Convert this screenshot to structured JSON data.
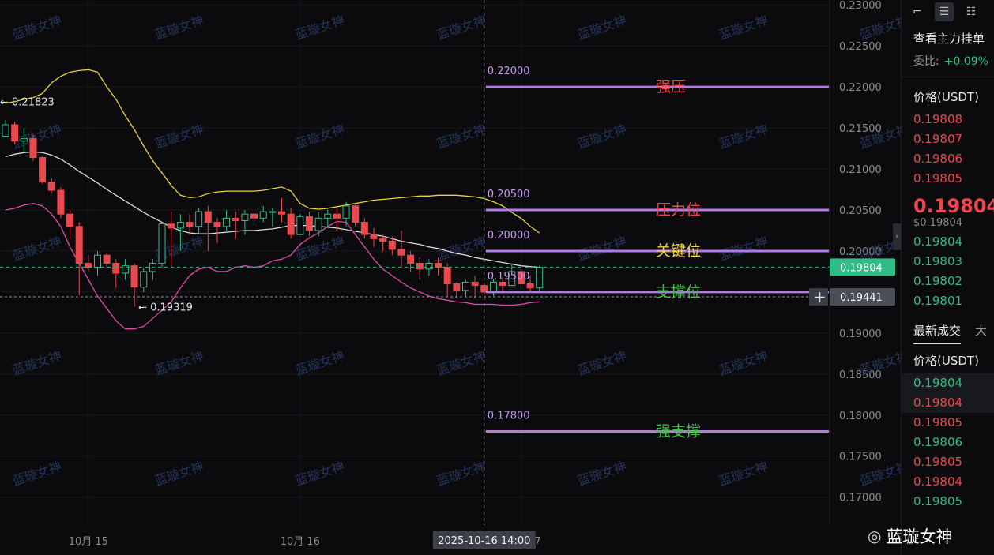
{
  "watermark": "蓝璇女神",
  "chart_data": {
    "type": "candlestick",
    "ylim": [
      0.1666,
      0.2306
    ],
    "y_ticks": [
      "0.23000",
      "0.22500",
      "0.22000",
      "0.21500",
      "0.21000",
      "0.20500",
      "0.20000",
      "0.19500",
      "0.19000",
      "0.18500",
      "0.18000",
      "0.17500",
      "0.17000"
    ],
    "x_ticks": [
      {
        "label": "10月 15",
        "index": 9
      },
      {
        "label": "10月 16",
        "index": 32
      },
      {
        "label": "10月 17",
        "index": 56
      }
    ],
    "crosshair": {
      "label": "2025-10-16 14:00",
      "index": 52
    },
    "current_price": "0.19804",
    "cursor_price": "0.19441",
    "annotations": {
      "high": {
        "label": "← 0.21823",
        "value": 0.21823,
        "index": 0
      },
      "low": {
        "label": "← 0.19319",
        "value": 0.19319,
        "index": 14
      }
    },
    "levels": [
      {
        "value": 0.22,
        "value_label": "0.22000",
        "name": "强压",
        "color": "#f0454c"
      },
      {
        "value": 0.205,
        "value_label": "0.20500",
        "name": "压力位",
        "color": "#f0454c"
      },
      {
        "value": 0.2,
        "value_label": "0.20000",
        "name": "关键位",
        "color": "#f5d142"
      },
      {
        "value": 0.195,
        "value_label": "0.19500",
        "name": "支撑位",
        "color": "#3fbf3f"
      },
      {
        "value": 0.178,
        "value_label": "0.17800",
        "name": "强支撑",
        "color": "#3fbf3f"
      }
    ],
    "candles": [
      [
        0.214,
        0.2154,
        0.215,
        0.216
      ],
      [
        0.2154,
        0.2134,
        0.213,
        0.2158
      ],
      [
        0.2134,
        0.2137,
        0.212,
        0.215
      ],
      [
        0.2137,
        0.2114,
        0.211,
        0.2142
      ],
      [
        0.2114,
        0.2084,
        0.2082,
        0.2116
      ],
      [
        0.2084,
        0.2074,
        0.207,
        0.2089
      ],
      [
        0.2074,
        0.2045,
        0.204,
        0.2078
      ],
      [
        0.2045,
        0.203,
        0.2015,
        0.205
      ],
      [
        0.203,
        0.1985,
        0.1946,
        0.2035
      ],
      [
        0.1985,
        0.198,
        0.1975,
        0.1995
      ],
      [
        0.198,
        0.1995,
        0.197,
        0.2
      ],
      [
        0.1995,
        0.1985,
        0.198,
        0.1998
      ],
      [
        0.1985,
        0.1973,
        0.1955,
        0.199
      ],
      [
        0.1973,
        0.1982,
        0.1965,
        0.199
      ],
      [
        0.1982,
        0.1956,
        0.1932,
        0.1985
      ],
      [
        0.1956,
        0.1975,
        0.195,
        0.198
      ],
      [
        0.1975,
        0.1985,
        0.1965,
        0.199
      ],
      [
        0.1985,
        0.2033,
        0.198,
        0.2035
      ],
      [
        0.2033,
        0.2028,
        0.198,
        0.2048
      ],
      [
        0.2028,
        0.2035,
        0.2,
        0.2045
      ],
      [
        0.2035,
        0.203,
        0.202,
        0.2045
      ],
      [
        0.203,
        0.2048,
        0.202,
        0.2052
      ],
      [
        0.2048,
        0.2035,
        0.2,
        0.2055
      ],
      [
        0.2035,
        0.203,
        0.201,
        0.204
      ],
      [
        0.203,
        0.204,
        0.2025,
        0.205
      ],
      [
        0.204,
        0.2037,
        0.2015,
        0.2048
      ],
      [
        0.2037,
        0.2045,
        0.202,
        0.205
      ],
      [
        0.2045,
        0.204,
        0.203,
        0.205
      ],
      [
        0.204,
        0.2048,
        0.2035,
        0.2055
      ],
      [
        0.2048,
        0.2048,
        0.203,
        0.2052
      ],
      [
        0.2048,
        0.2045,
        0.2035,
        0.2065
      ],
      [
        0.2045,
        0.202,
        0.2015,
        0.2052
      ],
      [
        0.202,
        0.2042,
        0.202,
        0.2045
      ],
      [
        0.2042,
        0.2025,
        0.2018,
        0.2048
      ],
      [
        0.2025,
        0.204,
        0.2018,
        0.2048
      ],
      [
        0.204,
        0.2045,
        0.2028,
        0.205
      ],
      [
        0.2045,
        0.204,
        0.2025,
        0.2052
      ],
      [
        0.204,
        0.2055,
        0.203,
        0.206
      ],
      [
        0.2055,
        0.2035,
        0.203,
        0.2058
      ],
      [
        0.2035,
        0.202,
        0.2015,
        0.204
      ],
      [
        0.202,
        0.2015,
        0.2005,
        0.2028
      ],
      [
        0.2015,
        0.2012,
        0.2,
        0.202
      ],
      [
        0.2012,
        0.2002,
        0.1995,
        0.2018
      ],
      [
        0.2002,
        0.1995,
        0.198,
        0.2025
      ],
      [
        0.1995,
        0.1985,
        0.1975,
        0.2
      ],
      [
        0.1985,
        0.1978,
        0.1965,
        0.1992
      ],
      [
        0.1978,
        0.1985,
        0.197,
        0.199
      ],
      [
        0.1985,
        0.198,
        0.197,
        0.1992
      ],
      [
        0.198,
        0.196,
        0.1945,
        0.1985
      ],
      [
        0.196,
        0.1952,
        0.1942,
        0.1962
      ],
      [
        0.1952,
        0.1962,
        0.1945,
        0.1965
      ],
      [
        0.1962,
        0.1958,
        0.1942,
        0.197
      ],
      [
        0.1958,
        0.195,
        0.194,
        0.1962
      ],
      [
        0.195,
        0.1962,
        0.1945,
        0.1966
      ],
      [
        0.1962,
        0.1958,
        0.195,
        0.1968
      ],
      [
        0.1958,
        0.1975,
        0.1958,
        0.1985
      ],
      [
        0.1975,
        0.196,
        0.1955,
        0.1978
      ],
      [
        0.196,
        0.1955,
        0.195,
        0.197
      ],
      [
        0.1955,
        0.198,
        0.1952,
        0.1982
      ]
    ],
    "boll_upper": [
      0.218,
      0.2182,
      0.2185,
      0.2187,
      0.2192,
      0.2205,
      0.2213,
      0.2218,
      0.222,
      0.2221,
      0.2218,
      0.22,
      0.2185,
      0.2165,
      0.2148,
      0.2128,
      0.211,
      0.2095,
      0.208,
      0.2068,
      0.2065,
      0.2066,
      0.207,
      0.2072,
      0.2073,
      0.2073,
      0.2073,
      0.2073,
      0.2074,
      0.2076,
      0.2078,
      0.2073,
      0.2058,
      0.2052,
      0.2051,
      0.2052,
      0.2054,
      0.2056,
      0.2058,
      0.206,
      0.2062,
      0.2063,
      0.2064,
      0.2065,
      0.2066,
      0.2067,
      0.2067,
      0.2068,
      0.2068,
      0.2068,
      0.2067,
      0.2066,
      0.2064,
      0.206,
      0.2055,
      0.2047,
      0.204,
      0.203,
      0.2022
    ],
    "boll_mid": [
      0.2115,
      0.2118,
      0.212,
      0.2121,
      0.212,
      0.2117,
      0.2112,
      0.2105,
      0.2097,
      0.209,
      0.2083,
      0.2075,
      0.2068,
      0.2061,
      0.2054,
      0.2047,
      0.2041,
      0.2035,
      0.2029,
      0.2025,
      0.2022,
      0.2021,
      0.2021,
      0.2022,
      0.2023,
      0.2024,
      0.2025,
      0.2025,
      0.2026,
      0.2027,
      0.2029,
      0.2031,
      0.2031,
      0.2031,
      0.203,
      0.2029,
      0.2028,
      0.2026,
      0.2024,
      0.2022,
      0.202,
      0.2018,
      0.2015,
      0.2012,
      0.201,
      0.2008,
      0.2005,
      0.2003,
      0.2,
      0.1997,
      0.1995,
      0.1992,
      0.199,
      0.1988,
      0.1986,
      0.1984,
      0.1982,
      0.1981,
      0.198
    ],
    "boll_lower": [
      0.205,
      0.2052,
      0.2056,
      0.2058,
      0.2055,
      0.2045,
      0.203,
      0.2005,
      0.1985,
      0.1965,
      0.1945,
      0.193,
      0.1915,
      0.1905,
      0.1905,
      0.1908,
      0.1918,
      0.1928,
      0.1938,
      0.1955,
      0.197,
      0.1978,
      0.198,
      0.1975,
      0.1975,
      0.198,
      0.1982,
      0.198,
      0.1982,
      0.1988,
      0.199,
      0.1995,
      0.2008,
      0.2016,
      0.2022,
      0.203,
      0.2036,
      0.2035,
      0.202,
      0.2005,
      0.199,
      0.1978,
      0.197,
      0.1962,
      0.1955,
      0.195,
      0.1945,
      0.1942,
      0.194,
      0.1938,
      0.1937,
      0.1935,
      0.1935,
      0.1935,
      0.1934,
      0.1934,
      0.1935,
      0.1937,
      0.1938
    ]
  },
  "panel": {
    "title": "查看主力挂单",
    "ratio_label": "委比:",
    "ratio_value": "+0.09%",
    "price_header": "价格(USDT)",
    "asks": [
      "0.19808",
      "0.19807",
      "0.19806",
      "0.19805"
    ],
    "mid_price": "0.19804",
    "mid_fiat": "$0.19804",
    "bids": [
      "0.19804",
      "0.19803",
      "0.19802",
      "0.19801"
    ],
    "trades_tab": "最新成交",
    "trades_tab2": "大",
    "trades_price_header": "价格(USDT)",
    "trades": [
      {
        "price": "0.19804",
        "side": "bid"
      },
      {
        "price": "0.19804",
        "side": "ask"
      },
      {
        "price": "0.19805",
        "side": "ask"
      },
      {
        "price": "0.19806",
        "side": "bid"
      },
      {
        "price": "0.19805",
        "side": "ask"
      },
      {
        "price": "0.19804",
        "side": "ask"
      },
      {
        "price": "0.19805",
        "side": "bid"
      }
    ]
  },
  "brand_name": "蓝璇女神"
}
